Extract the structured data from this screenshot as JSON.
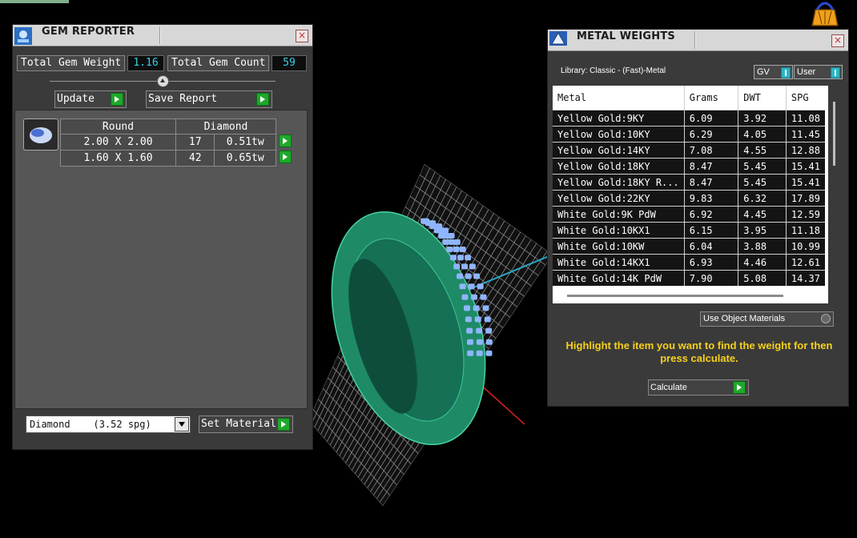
{
  "gem_reporter": {
    "title": "GEM REPORTER",
    "total_weight_label": "Total Gem Weight",
    "total_weight_value": "1.16",
    "total_count_label": "Total Gem Count",
    "total_count_value": "59",
    "update_label": "Update",
    "save_report_label": "Save Report",
    "table": {
      "shape": "Round",
      "material": "Diamond",
      "rows": [
        {
          "size": "2.00 X 2.00",
          "count": "17",
          "weight": "0.51tw"
        },
        {
          "size": "1.60 X 1.60",
          "count": "42",
          "weight": "0.65tw"
        }
      ]
    },
    "material_select": "Diamond    (3.52 spg)",
    "set_material_label": "Set Material"
  },
  "metal_weights": {
    "title": "METAL WEIGHTS",
    "library_label": "Library: Classic - (Fast)-Metal",
    "gv_label": "GV",
    "user_label": "User",
    "columns": [
      "Metal",
      "Grams",
      "DWT",
      "SPG"
    ],
    "rows": [
      [
        "Yellow Gold:9KY",
        "6.09",
        "3.92",
        "11.08"
      ],
      [
        "Yellow Gold:10KY",
        "6.29",
        "4.05",
        "11.45"
      ],
      [
        "Yellow Gold:14KY",
        "7.08",
        "4.55",
        "12.88"
      ],
      [
        "Yellow Gold:18KY",
        "8.47",
        "5.45",
        "15.41"
      ],
      [
        "Yellow Gold:18KY R...",
        "8.47",
        "5.45",
        "15.41"
      ],
      [
        "Yellow Gold:22KY",
        "9.83",
        "6.32",
        "17.89"
      ],
      [
        "White Gold:9K PdW",
        "6.92",
        "4.45",
        "12.59"
      ],
      [
        "White Gold:10KX1",
        "6.15",
        "3.95",
        "11.18"
      ],
      [
        "White Gold:10KW",
        "6.04",
        "3.88",
        "10.99"
      ],
      [
        "White Gold:14KX1",
        "6.93",
        "4.46",
        "12.61"
      ],
      [
        "White Gold:14K PdW",
        "7.90",
        "5.08",
        "14.37"
      ]
    ],
    "use_object_materials_label": "Use Object Materials",
    "instruction": "Highlight the item you want to find the weight for then press calculate.",
    "calculate_label": "Calculate"
  },
  "colors": {
    "ring": "#2faa7f",
    "gems": "#8fb5ff",
    "accent": "#1fa82b",
    "value_text": "#37d3e6",
    "instruction_text": "#f6d11a"
  }
}
